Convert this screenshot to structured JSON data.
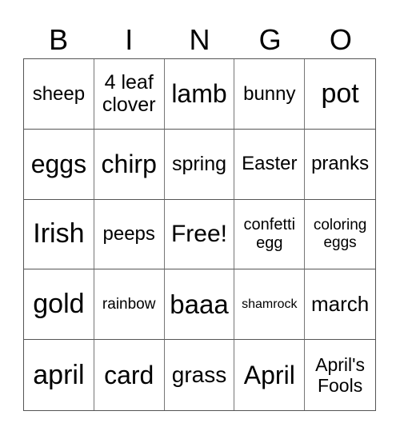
{
  "header": [
    "B",
    "I",
    "N",
    "G",
    "O"
  ],
  "cells": [
    {
      "text": "sheep",
      "size": 24
    },
    {
      "text": "4 leaf clover",
      "size": 25
    },
    {
      "text": "lamb",
      "size": 32
    },
    {
      "text": "bunny",
      "size": 24
    },
    {
      "text": "pot",
      "size": 34
    },
    {
      "text": "eggs",
      "size": 32
    },
    {
      "text": "chirp",
      "size": 32
    },
    {
      "text": "spring",
      "size": 25
    },
    {
      "text": "Easter",
      "size": 24
    },
    {
      "text": "pranks",
      "size": 24
    },
    {
      "text": "Irish",
      "size": 34
    },
    {
      "text": "peeps",
      "size": 24
    },
    {
      "text": "Free!",
      "size": 30
    },
    {
      "text": "confetti egg",
      "size": 20
    },
    {
      "text": "coloring eggs",
      "size": 19
    },
    {
      "text": "gold",
      "size": 34
    },
    {
      "text": "rainbow",
      "size": 19
    },
    {
      "text": "baaa",
      "size": 33
    },
    {
      "text": "shamrock",
      "size": 16
    },
    {
      "text": "march",
      "size": 26
    },
    {
      "text": "april",
      "size": 34
    },
    {
      "text": "card",
      "size": 32
    },
    {
      "text": "grass",
      "size": 28
    },
    {
      "text": "April",
      "size": 32
    },
    {
      "text": "April's Fools",
      "size": 23
    }
  ]
}
